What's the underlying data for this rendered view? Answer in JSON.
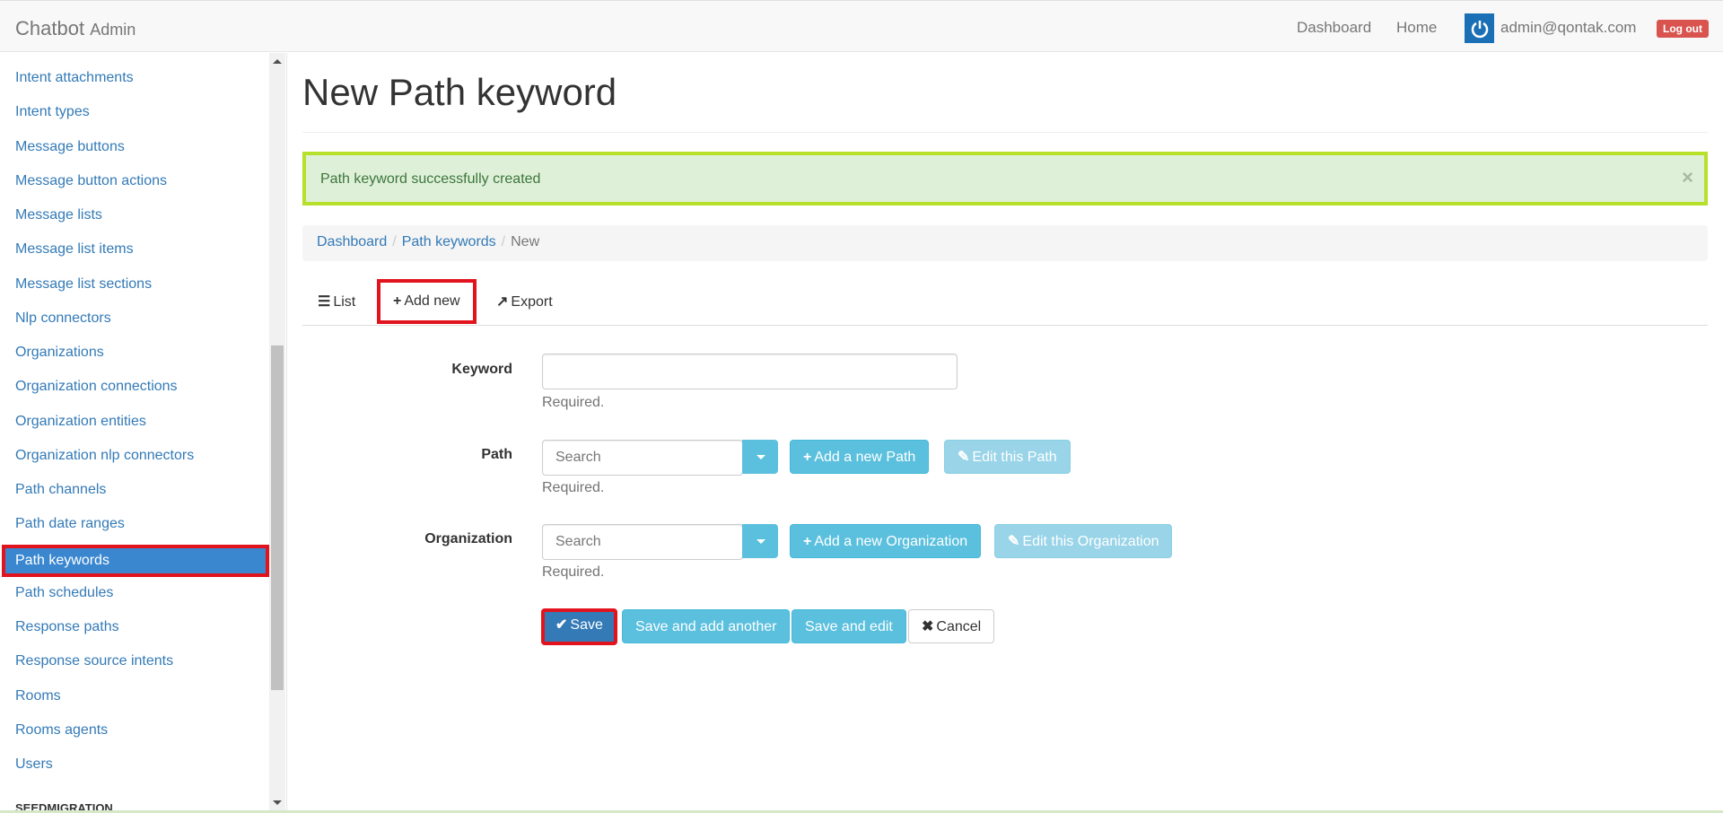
{
  "navbar": {
    "brand": "Chatbot",
    "brand_small": "Admin",
    "links": [
      "Dashboard",
      "Home"
    ],
    "user_email": "admin@qontak.com",
    "logout": "Log out"
  },
  "sidebar": {
    "items": [
      "Intent attachments",
      "Intent types",
      "Message buttons",
      "Message button actions",
      "Message lists",
      "Message list items",
      "Message list sections",
      "Nlp connectors",
      "Organizations",
      "Organization connections",
      "Organization entities",
      "Organization nlp connectors",
      "Path channels",
      "Path date ranges",
      "Path keywords",
      "Path schedules",
      "Response paths",
      "Response source intents",
      "Rooms",
      "Rooms agents",
      "Users"
    ],
    "active_item": "Path keywords",
    "section_heading": "SEEDMIGRATION"
  },
  "main": {
    "title": "New Path keyword",
    "alert": "Path keyword successfully created",
    "alert_close": "×",
    "breadcrumb": {
      "dashboard": "Dashboard",
      "path_keywords": "Path keywords",
      "current": "New",
      "sep": "/"
    },
    "tabs": {
      "list": "List",
      "add_new": "Add new",
      "export": "Export"
    },
    "form": {
      "keyword_label": "Keyword",
      "keyword_help": "Required.",
      "path_label": "Path",
      "path_placeholder": "Search",
      "path_help": "Required.",
      "add_path": "Add a new Path",
      "edit_path": "Edit this Path",
      "org_label": "Organization",
      "org_placeholder": "Search",
      "org_help": "Required.",
      "add_org": "Add a new Organization",
      "edit_org": "Edit this Organization"
    },
    "actions": {
      "save": "Save",
      "save_add": "Save and add another",
      "save_edit": "Save and edit",
      "cancel": "Cancel"
    }
  },
  "colors": {
    "accent": "#337ab7",
    "info": "#5bc0de",
    "highlight": "#e1141e",
    "alert_border": "#b7e02a"
  }
}
